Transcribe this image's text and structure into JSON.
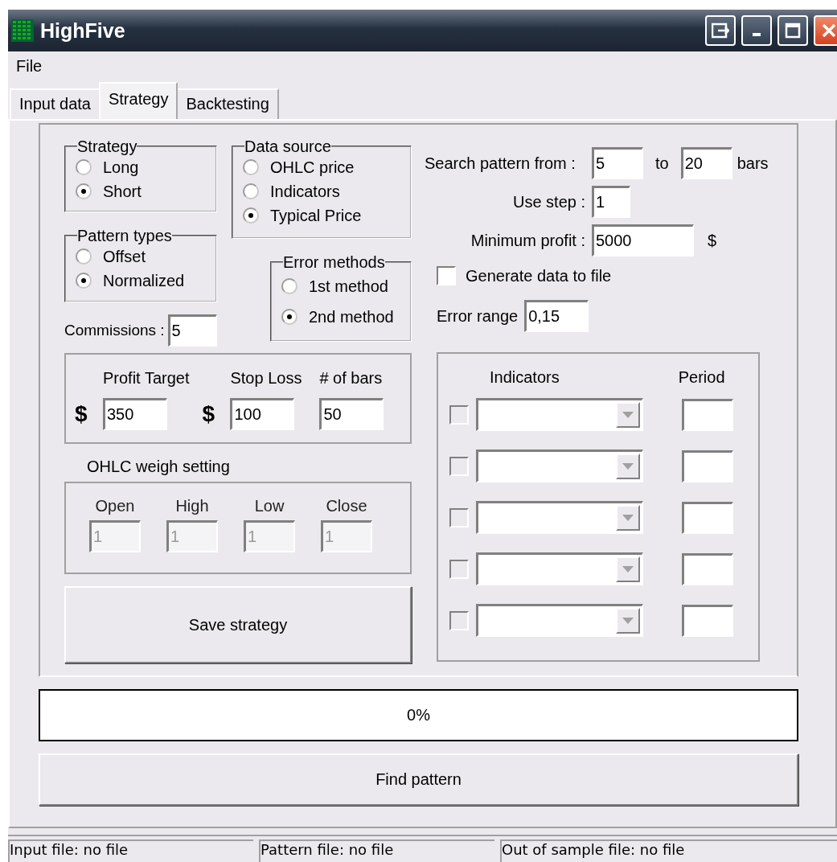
{
  "window": {
    "title": "HighFive"
  },
  "menu": [
    {
      "label": "File"
    }
  ],
  "tabs": [
    {
      "label": "Input data",
      "selected": false
    },
    {
      "label": "Strategy",
      "selected": true
    },
    {
      "label": "Backtesting",
      "selected": false
    }
  ],
  "strategy_group": {
    "title": "Strategy",
    "options": [
      {
        "label": "Long",
        "selected": false
      },
      {
        "label": "Short",
        "selected": true
      }
    ]
  },
  "pattern_types": {
    "title": "Pattern types",
    "options": [
      {
        "label": "Offset",
        "selected": false
      },
      {
        "label": "Normalized",
        "selected": true
      }
    ]
  },
  "data_source": {
    "title": "Data source",
    "options": [
      {
        "label": "OHLC price",
        "selected": false
      },
      {
        "label": "Indicators",
        "selected": false
      },
      {
        "label": "Typical Price",
        "selected": true
      }
    ]
  },
  "error_methods": {
    "title": "Error methods",
    "options": [
      {
        "label": "1st method",
        "selected": false
      },
      {
        "label": "2nd method",
        "selected": true
      }
    ]
  },
  "commissions": {
    "label": "Commissions :",
    "value": "5"
  },
  "targets": [
    {
      "label": "Profit Target",
      "prefix": "$",
      "value": "350"
    },
    {
      "label": "Stop Loss",
      "prefix": "$",
      "value": "100"
    },
    {
      "label": "# of bars",
      "value": "50"
    }
  ],
  "ohlc_weights": {
    "title": "OHLC weigh setting",
    "fields": [
      {
        "label": "Open",
        "value": "1",
        "disabled": true
      },
      {
        "label": "High",
        "value": "1",
        "disabled": true
      },
      {
        "label": "Low",
        "value": "1",
        "disabled": true
      },
      {
        "label": "Close",
        "value": "1",
        "disabled": true
      }
    ]
  },
  "save_button": "Save strategy",
  "search": {
    "label": "Search pattern from :",
    "from": "5",
    "to_label": "to",
    "to": "20",
    "unit": "bars"
  },
  "step": {
    "label": "Use step :",
    "value": "1"
  },
  "min_profit": {
    "label": "Minimum profit :",
    "value": "5000",
    "unit": "$"
  },
  "generate": {
    "label": "Generate data to file",
    "checked": false
  },
  "error_range": {
    "label": "Error range",
    "value": "0,15"
  },
  "indicators": {
    "header": "Indicators",
    "period_header": "Period",
    "rows": [
      {
        "checked": false,
        "disabled": true
      },
      {
        "checked": false,
        "disabled": true
      },
      {
        "checked": false,
        "disabled": true
      },
      {
        "checked": false,
        "disabled": true
      },
      {
        "checked": false,
        "disabled": true
      }
    ]
  },
  "progress": {
    "level": 0,
    "text": "0%"
  },
  "find_button": "Find pattern",
  "status_bar": [
    "Input file: no file",
    "Pattern file: no file",
    "Out of sample file: no file"
  ]
}
